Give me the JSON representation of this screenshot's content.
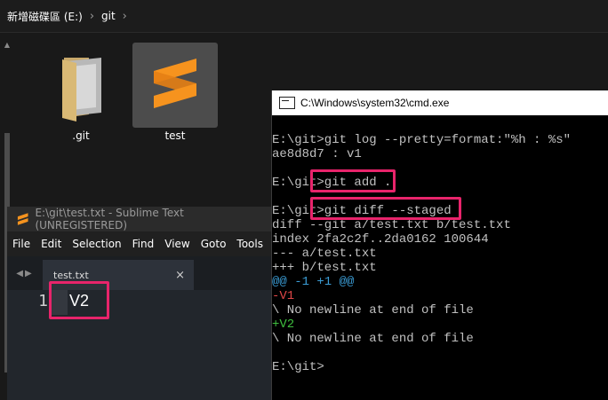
{
  "explorer": {
    "breadcrumb": [
      "新增磁碟區 (E:)",
      "git"
    ],
    "files": [
      {
        "name": ".git",
        "kind": "folder"
      },
      {
        "name": "test",
        "kind": "sublime-file"
      }
    ]
  },
  "cmd": {
    "title": "C:\\Windows\\system32\\cmd.exe",
    "lines": [
      {
        "text": "E:\\git>git log --pretty=format:\"%h : %s\"",
        "color": "default"
      },
      {
        "text": "ae8d8d7 : v1",
        "color": "default"
      },
      {
        "text": "",
        "color": "default"
      },
      {
        "text": "E:\\git>git add .",
        "color": "default"
      },
      {
        "text": "",
        "color": "default"
      },
      {
        "text": "E:\\git>git diff --staged",
        "color": "default"
      },
      {
        "text": "diff --git a/test.txt b/test.txt",
        "color": "default"
      },
      {
        "text": "index 2fa2c2f..2da0162 100644",
        "color": "default"
      },
      {
        "text": "--- a/test.txt",
        "color": "default"
      },
      {
        "text": "+++ b/test.txt",
        "color": "default"
      },
      {
        "text": "@@ -1 +1 @@",
        "color": "cyan"
      },
      {
        "text": "-V1",
        "color": "red"
      },
      {
        "text": "\\ No newline at end of file",
        "color": "default"
      },
      {
        "text": "+V2",
        "color": "green"
      },
      {
        "text": "\\ No newline at end of file",
        "color": "default"
      },
      {
        "text": "",
        "color": "default"
      },
      {
        "text": "E:\\git>",
        "color": "default"
      }
    ]
  },
  "sublime": {
    "title": "E:\\git\\test.txt - Sublime Text (UNREGISTERED)",
    "menu": [
      "File",
      "Edit",
      "Selection",
      "Find",
      "View",
      "Goto",
      "Tools"
    ],
    "tab": {
      "label": "test.txt",
      "close": "×"
    },
    "editor": {
      "line_number": "1",
      "content": "V2"
    }
  },
  "colors": {
    "highlight": "#e8246b",
    "accent": "#f6931e"
  }
}
